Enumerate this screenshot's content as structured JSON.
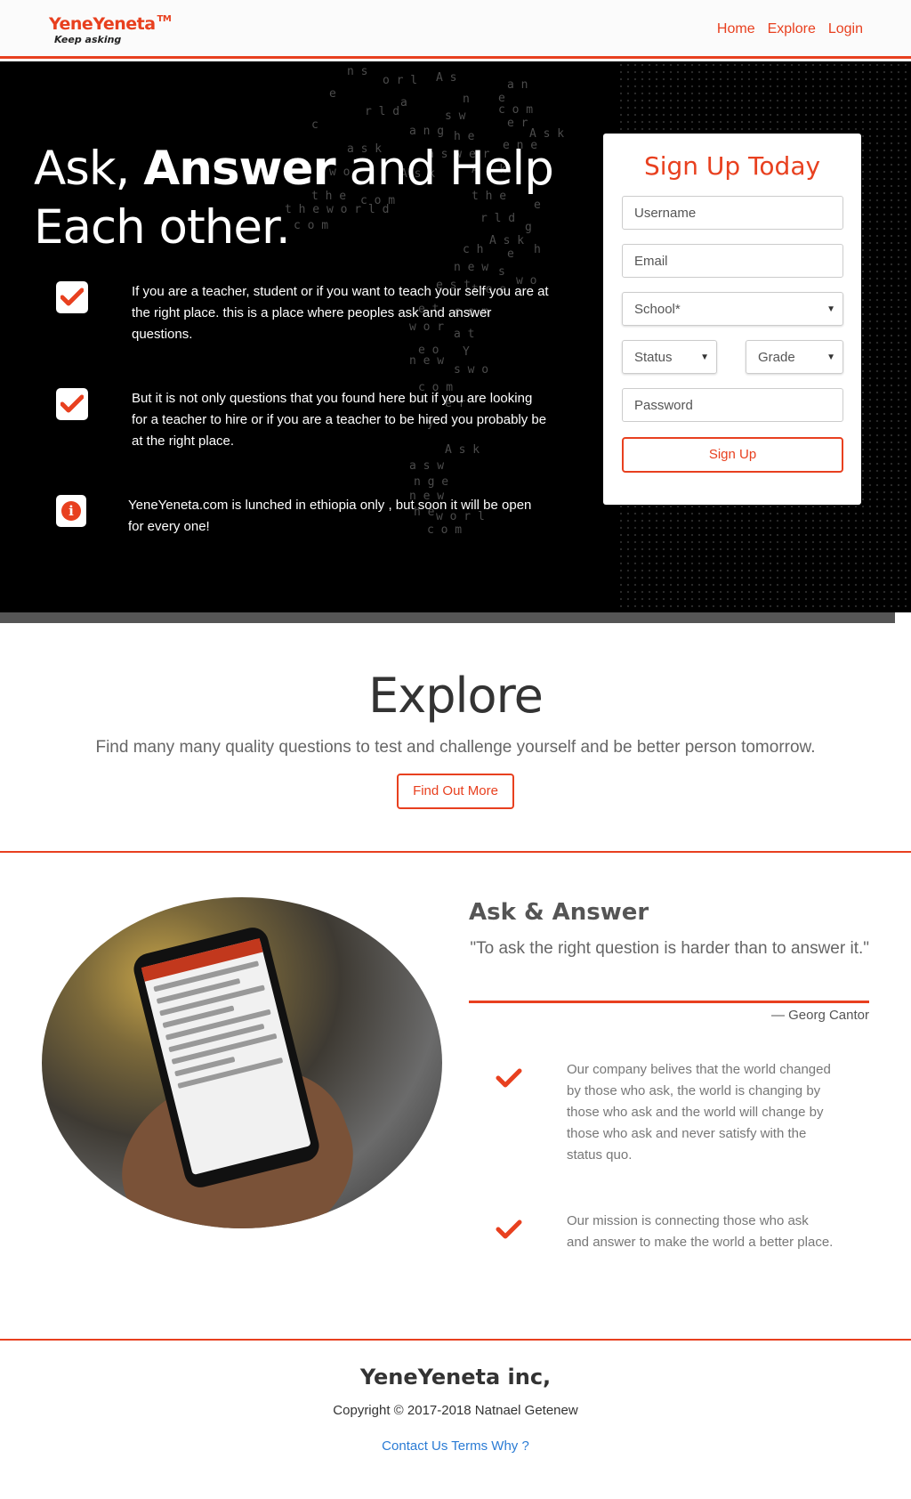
{
  "navbar": {
    "brand": "YeneYeneta",
    "brand_tm": "TM",
    "tagline": "Keep asking",
    "links": [
      "Home",
      "Explore",
      "Login"
    ]
  },
  "hero": {
    "title_part1": "Ask, ",
    "title_bold": "Answer",
    "title_part2": " and Help",
    "title_line2": "Each other.",
    "features": [
      {
        "icon": "check-icon",
        "text": "If you are a teacher, student or if you want to teach your self you are at the right place. this is a place where peoples ask and answer questions."
      },
      {
        "icon": "check-icon",
        "text": "But it is not only questions that you found here but if you are looking for a teacher to hire or if you are a teacher to be hired you probably be at the right place."
      },
      {
        "icon": "info-icon",
        "text": "YeneYeneta.com is lunched in ethiopia only , but soon it will be open for every one!"
      }
    ]
  },
  "signup": {
    "title": "Sign Up Today",
    "username_placeholder": "Username",
    "email_placeholder": "Email",
    "school_label": "School*",
    "status_label": "Status",
    "grade_label": "Grade",
    "password_placeholder": "Password",
    "button": "Sign Up"
  },
  "explore": {
    "title": "Explore",
    "subtitle": "Find many many quality questions to test and challenge yourself and be better person tomorrow.",
    "button": "Find Out More"
  },
  "ask_answer": {
    "title": "Ask & Answer",
    "quote": "\"To ask the right question is harder than to answer it.\"",
    "author": "— Georg Cantor",
    "items": [
      "Our company belives that the world changed by those who ask, the world is changing by those who ask and the world will change by those who ask and never satisfy with the status quo.",
      "Our mission is connecting those who ask and answer to make the world a better place."
    ]
  },
  "footer": {
    "title": "YeneYeneta inc,",
    "copyright": "Copyright © 2017-2018 Natnael Getenew",
    "links": [
      "Contact Us",
      "Terms",
      "Why ?"
    ]
  },
  "colors": {
    "accent": "#e8401f",
    "link": "#2a7bd4"
  }
}
